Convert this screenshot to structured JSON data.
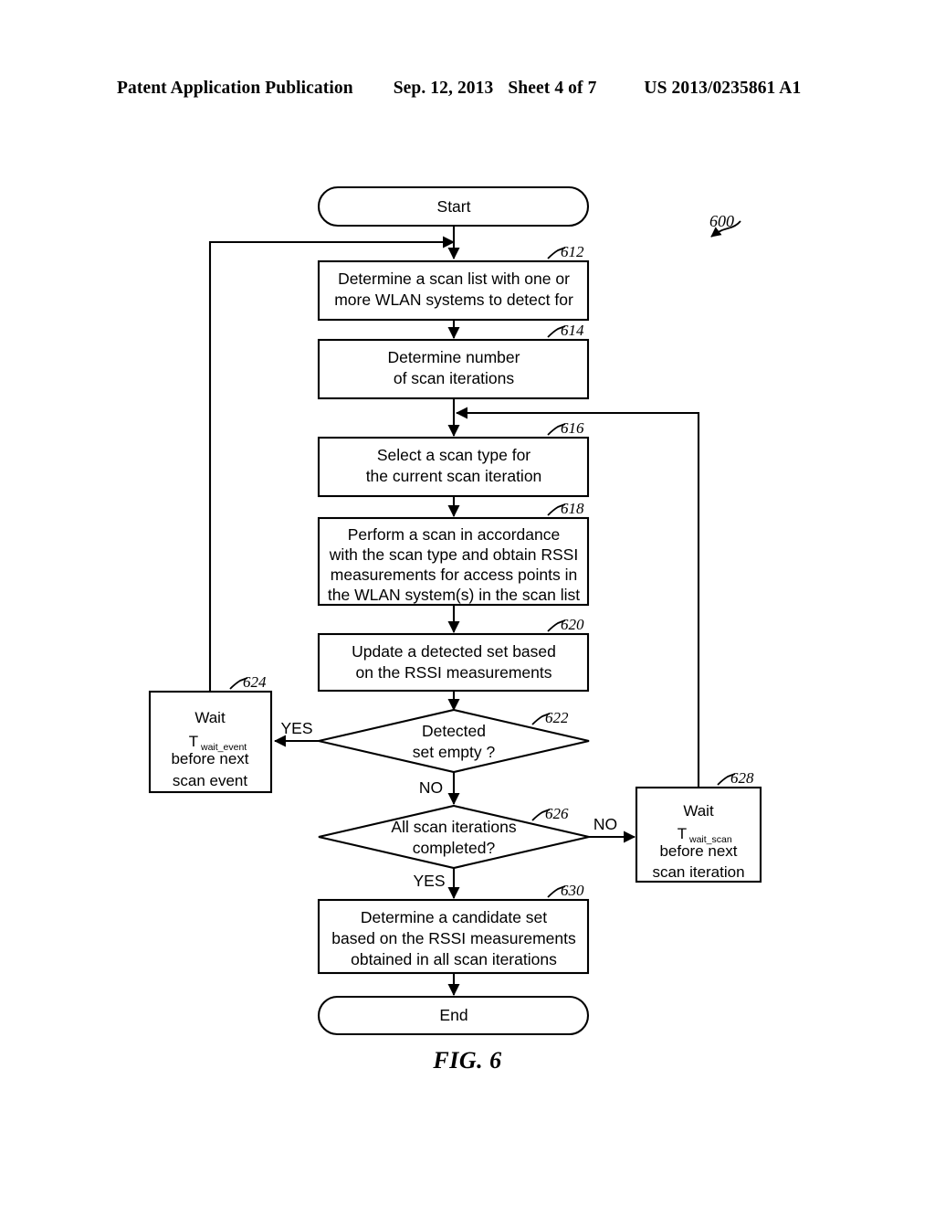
{
  "header": {
    "publication": "Patent Application Publication",
    "date": "Sep. 12, 2013",
    "sheet": "Sheet 4 of 7",
    "doc_number": "US 2013/0235861 A1"
  },
  "figure": {
    "caption": "FIG. 6",
    "diagram_ref": "600"
  },
  "nodes": {
    "start": {
      "ref": "",
      "label": "Start"
    },
    "n612": {
      "ref": "612",
      "lines": [
        "Determine a scan list with one or",
        "more WLAN systems to detect for"
      ]
    },
    "n614": {
      "ref": "614",
      "lines": [
        "Determine number",
        "of scan iterations"
      ]
    },
    "n616": {
      "ref": "616",
      "lines": [
        "Select a scan type for",
        "the current scan iteration"
      ]
    },
    "n618": {
      "ref": "618",
      "lines": [
        "Perform a scan in accordance",
        "with the scan type and obtain RSSI",
        "measurements for access points in",
        "the WLAN system(s) in the scan list"
      ]
    },
    "n620": {
      "ref": "620",
      "lines": [
        "Update a detected set based",
        "on the RSSI measurements"
      ]
    },
    "n622": {
      "ref": "622",
      "lines": [
        "Detected",
        "set empty ?"
      ]
    },
    "n624": {
      "ref": "624",
      "line1": "Wait",
      "timer_base": "T",
      "timer_sub": "wait_event",
      "line3": "before next",
      "line4": "scan event"
    },
    "n626": {
      "ref": "626",
      "lines": [
        "All scan iterations",
        "completed?"
      ]
    },
    "n628": {
      "ref": "628",
      "line1": "Wait",
      "timer_base": "T",
      "timer_sub": "wait_scan",
      "line3": "before next",
      "line4": "scan iteration"
    },
    "n630": {
      "ref": "630",
      "lines": [
        "Determine a candidate set",
        "based on the RSSI measurements",
        "obtained in all scan iterations"
      ]
    },
    "end": {
      "ref": "",
      "label": "End"
    }
  },
  "edge_labels": {
    "yes_622": "YES",
    "no_622": "NO",
    "no_626": "NO",
    "yes_626": "YES"
  },
  "colors": {
    "ink": "#000000",
    "paper": "#ffffff"
  }
}
